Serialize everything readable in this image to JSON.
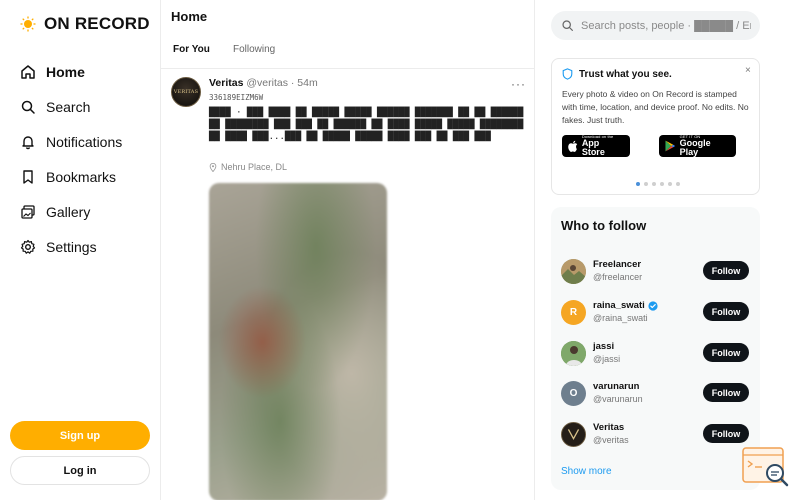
{
  "brand": {
    "name": "ON RECORD"
  },
  "nav": {
    "items": [
      {
        "label": "Home",
        "icon": "home-icon"
      },
      {
        "label": "Search",
        "icon": "search-icon"
      },
      {
        "label": "Notifications",
        "icon": "bell-icon"
      },
      {
        "label": "Bookmarks",
        "icon": "bookmark-icon"
      },
      {
        "label": "Gallery",
        "icon": "gallery-icon"
      },
      {
        "label": "Settings",
        "icon": "gear-icon"
      }
    ],
    "signup_label": "Sign up",
    "login_label": "Log in"
  },
  "feed": {
    "title": "Home",
    "tabs": [
      {
        "label": "For You",
        "active": true
      },
      {
        "label": "Following",
        "active": false
      }
    ],
    "post": {
      "avatar_text": "VERITAS",
      "author": "Veritas",
      "meta": "@veritas · 54m",
      "more": "···",
      "code": "336189EIZM6W",
      "body": "████ · ███ ████ ██ █████ █████ ██████ ███████ ██ ██ ████████ ████████ ███ ███ ██ ██████ ██ ████ █████ █████ ████████ ██ ████ ███...███ ██ █████ █████ ████ ███ ██ ███ ███",
      "location": "Nehru Place, DL"
    }
  },
  "sidebar": {
    "search_placeholder": "Search posts, people · █████ / Eng",
    "trust": {
      "title": "Trust what you see.",
      "close": "×",
      "text": "Every photo & video on On Record is stamped with time, location, and device proof. No edits. No fakes. Just truth.",
      "apple_small": "Download on the",
      "apple_big": "App Store",
      "google_small": "GET IT ON",
      "google_big": "Google Play"
    },
    "who_to_follow": {
      "title": "Who to follow",
      "accounts": [
        {
          "name": "Freelancer",
          "handle": "@freelancer",
          "initial": "",
          "avatar_color": "#8a9a6a",
          "verified": false
        },
        {
          "name": "raina_swati",
          "handle": "@raina_swati",
          "initial": "R",
          "avatar_color": "#f5a623",
          "verified": true
        },
        {
          "name": "jassi",
          "handle": "@jassi",
          "initial": "",
          "avatar_color": "#6f8f5a",
          "verified": false
        },
        {
          "name": "varunarun",
          "handle": "@varunarun",
          "initial": "O",
          "avatar_color": "#6e7f8e",
          "verified": false
        },
        {
          "name": "Veritas",
          "handle": "@veritas",
          "initial": "",
          "avatar_color": "#2a241d",
          "verified": false
        }
      ],
      "follow_label": "Follow",
      "show_more": "Show more"
    }
  },
  "colors": {
    "accent": "#ffae00",
    "link": "#1d9bf0",
    "follow_button": "#0f1419",
    "verified": "#1d9bf0"
  }
}
